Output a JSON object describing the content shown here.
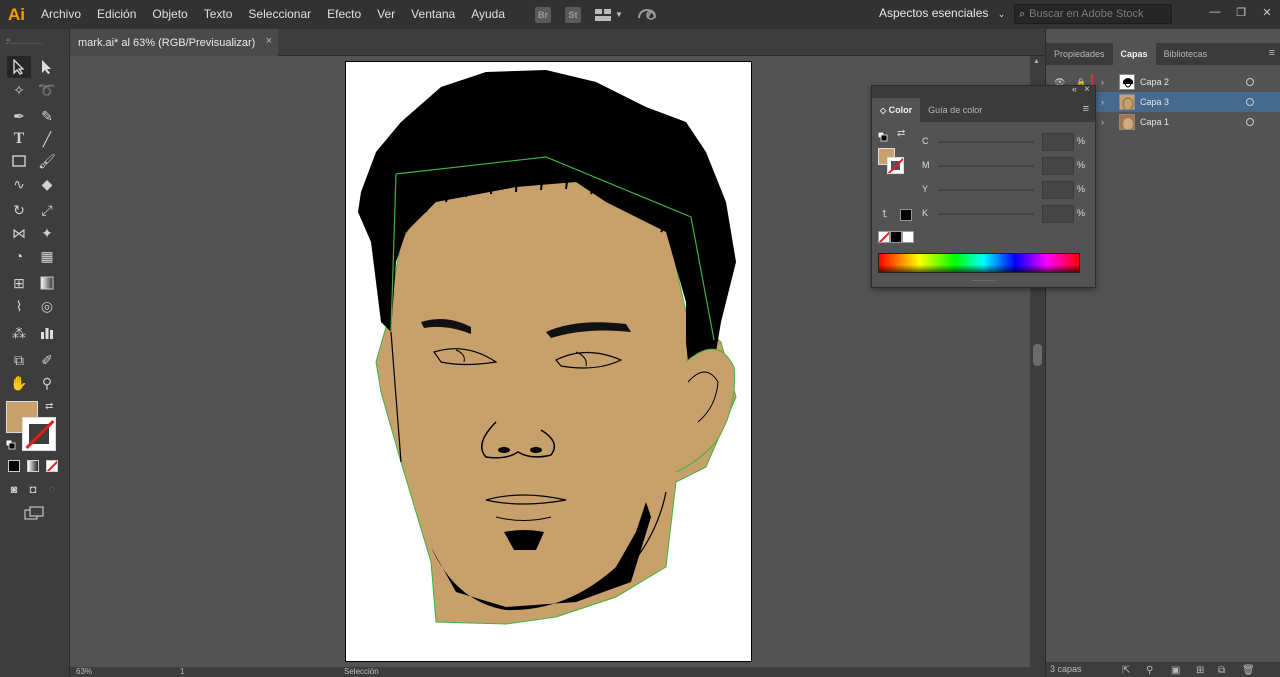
{
  "app": {
    "logo": "Ai",
    "menu": [
      "Archivo",
      "Edición",
      "Objeto",
      "Texto",
      "Seleccionar",
      "Efecto",
      "Ver",
      "Ventana",
      "Ayuda"
    ],
    "menubar_icons": [
      "Br",
      "St"
    ],
    "workspace": "Aspectos esenciales",
    "search_placeholder": "Buscar en Adobe Stock",
    "window_controls": [
      "—",
      "❐",
      "✕"
    ]
  },
  "document": {
    "tab_title": "mark.ai* al 63% (RGB/Previsualizar)",
    "close_glyph": "×"
  },
  "toolbar": {
    "tools": [
      "selection-tool",
      "direct-selection-tool",
      "magic-wand-tool",
      "lasso-tool",
      "pen-tool",
      "curvature-tool",
      "type-tool",
      "line-tool",
      "rectangle-tool",
      "paintbrush-tool",
      "shaper-tool",
      "eraser-tool",
      "rotate-tool",
      "scale-tool",
      "width-tool",
      "puppet-warp-tool",
      "shape-builder-tool",
      "perspective-grid-tool",
      "mesh-tool",
      "gradient-tool",
      "eyedropper-tool",
      "blend-tool",
      "symbol-sprayer-tool",
      "column-graph-tool",
      "artboard-tool",
      "slice-tool",
      "hand-tool",
      "zoom-tool"
    ],
    "fill_color": "#c8a06c",
    "stroke_color": "none"
  },
  "status": {
    "zoom": "63%",
    "artboard_number": "1",
    "tool_label": "Selección"
  },
  "right_panel": {
    "tabs": [
      "Propiedades",
      "Capas",
      "Bibliotecas"
    ],
    "active_tab": "Capas",
    "layers": [
      {
        "name": "Capa 2",
        "highlighted": false
      },
      {
        "name": "Capa 3",
        "highlighted": true
      },
      {
        "name": "Capa 1",
        "highlighted": false
      }
    ],
    "footer": "3 capas"
  },
  "color_panel": {
    "tabs": [
      "Color",
      "Guía de color"
    ],
    "active_tab": "Color",
    "channels": [
      "C",
      "M",
      "Y",
      "K"
    ],
    "percent": "%"
  },
  "artwork": {
    "skin_color": "#c8a06c",
    "hair_color": "#000000",
    "outline_color": "#3fb33f"
  }
}
